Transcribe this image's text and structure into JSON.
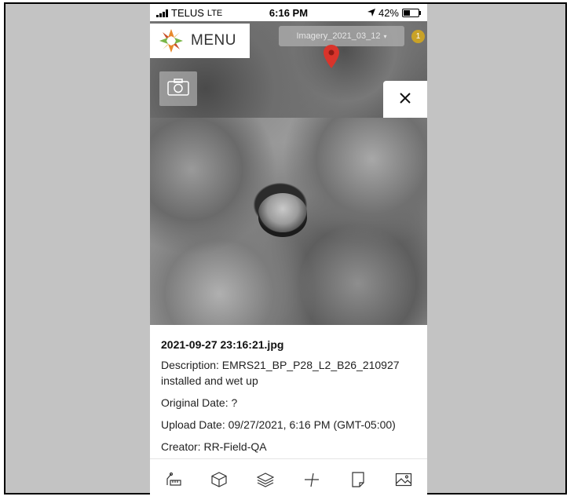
{
  "status_bar": {
    "carrier": "TELUS",
    "network": "LTE",
    "time": "6:16 PM",
    "battery": "42%",
    "battery_level": 0.42
  },
  "map": {
    "menu_label": "MENU",
    "imagery_selector": "Imagery_2021_03_12",
    "notification_count": "1"
  },
  "photo_details": {
    "filename": "2021-09-27 23:16:21.jpg",
    "description": "Description: EMRS21_BP_P28_L2_B26_210927 installed and wet up",
    "original_date": "Original Date: ?",
    "upload_date": "Upload Date: 09/27/2021, 6:16 PM (GMT-05:00)",
    "creator": "Creator: RR-Field-QA"
  },
  "toolbar": {
    "icons": [
      "measure-icon",
      "3d-box-icon",
      "layers-icon",
      "add-point-icon",
      "notes-icon",
      "image-gallery-icon"
    ]
  },
  "colors": {
    "pin": "#d9342b",
    "logo_orange": "#e8892b",
    "logo_green": "#7ab648",
    "badge": "#c9a227"
  }
}
